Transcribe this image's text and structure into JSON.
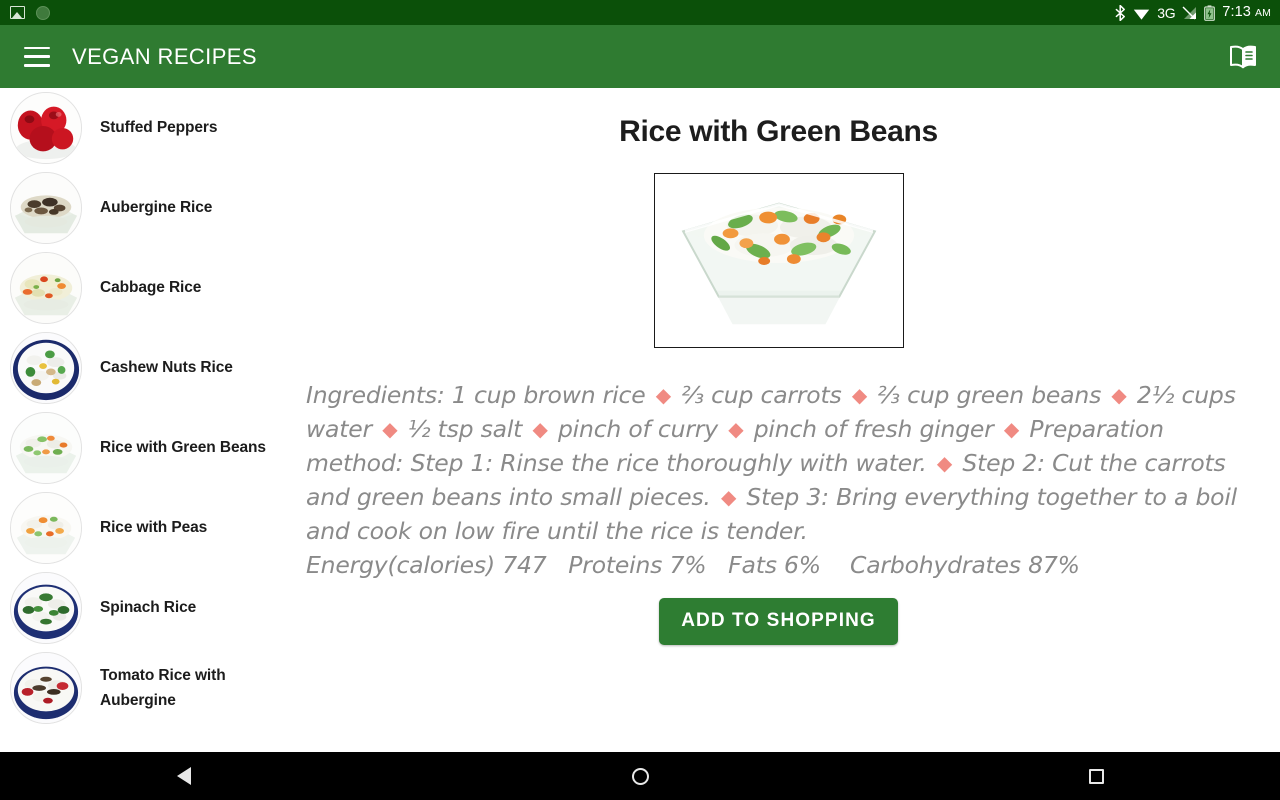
{
  "status_bar": {
    "notification_icons": [
      "image-icon",
      "circle-badge-icon"
    ],
    "right_icons": [
      "bluetooth-icon",
      "wifi-icon",
      "signal-icon",
      "battery-charging-icon"
    ],
    "network_label": "3G",
    "time": "7:13",
    "time_suffix": "AM"
  },
  "app_bar": {
    "menu_icon": "hamburger-icon",
    "title": "VEGAN RECIPES",
    "action_icon": "open-book-icon"
  },
  "sidebar": {
    "items": [
      {
        "label": "Stuffed Peppers",
        "thumb": "stuffed-peppers"
      },
      {
        "label": "Aubergine Rice",
        "thumb": "aubergine-rice"
      },
      {
        "label": "Cabbage Rice",
        "thumb": "cabbage-rice"
      },
      {
        "label": "Cashew Nuts Rice",
        "thumb": "cashew-nuts-rice"
      },
      {
        "label": "Rice with Green Beans",
        "thumb": "rice-green-beans"
      },
      {
        "label": "Rice with Peas",
        "thumb": "rice-peas"
      },
      {
        "label": "Spinach Rice",
        "thumb": "spinach-rice"
      },
      {
        "label": "Tomato Rice with Aubergine",
        "thumb": "tomato-rice-aubergine"
      }
    ]
  },
  "detail": {
    "title": "Rice with Green Beans",
    "image_alt": "glass-bowl-of-rice-with-green-beans-and-carrots",
    "ingredients_heading": "Ingredients:",
    "ingredients": [
      "1 cup brown rice",
      "⅔ cup carrots",
      "⅔ cup green beans",
      "2½ cups water",
      "½ tsp salt",
      "pinch of curry",
      "pinch of fresh ginger"
    ],
    "preparation_heading": "Preparation method:",
    "steps": [
      "Step 1: Rinse the rice thoroughly with water.",
      "Step 2: Cut the carrots and green beans into small pieces.",
      "Step 3: Bring everything together to a boil and cook on low fire until the rice is tender."
    ],
    "nutrition": "Energy(calories) 747   Proteins 7%   Fats 6%    Carbohydrates 87%",
    "add_button_label": "ADD TO SHOPPING",
    "separator_glyph": "◆",
    "separator_color": "#f08a82"
  },
  "nav_bar": {
    "back_label": "back-icon",
    "home_label": "home-icon",
    "recents_label": "recents-icon"
  },
  "colors": {
    "status_bar": "#0b5009",
    "app_bar": "#2f7b31",
    "accent_button": "#2e7d32",
    "body_text": "#8a8a8a",
    "diamond": "#f08a82"
  }
}
